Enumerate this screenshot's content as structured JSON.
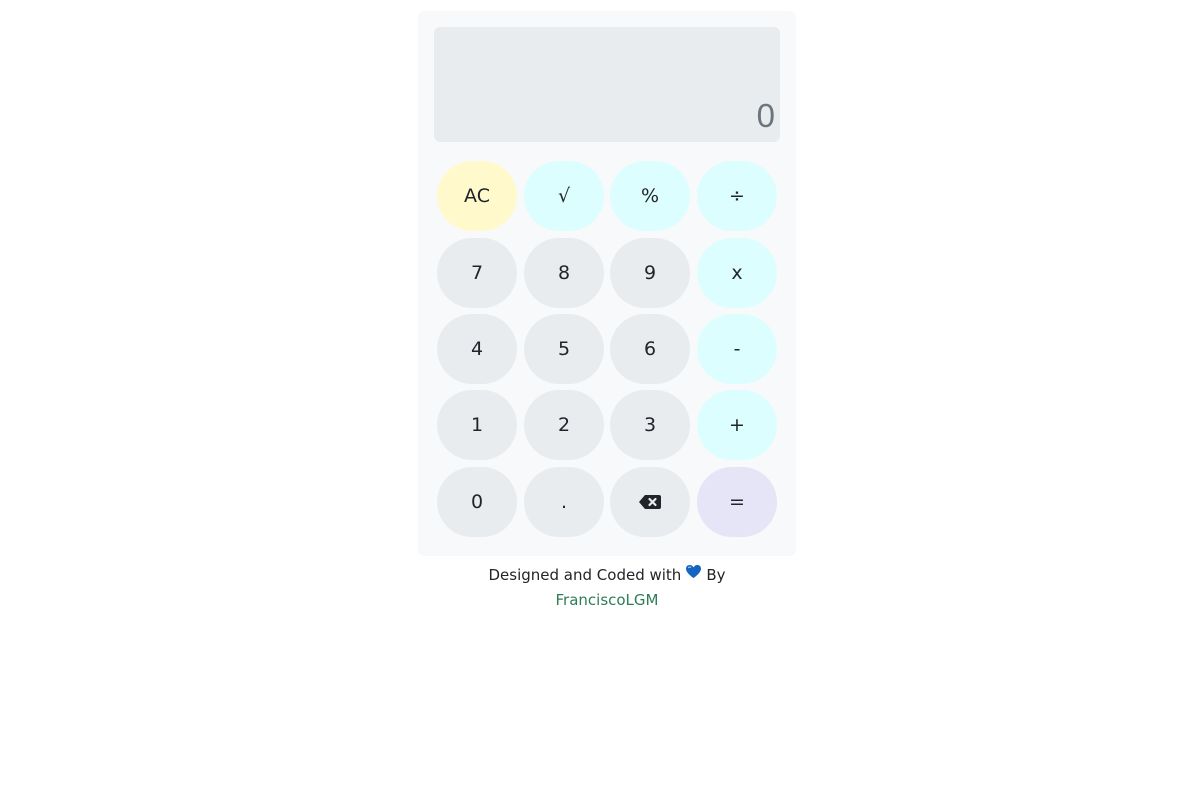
{
  "display": {
    "value": "0"
  },
  "keys": {
    "ac": "AC",
    "sqrt": "√",
    "percent": "%",
    "divide": "÷",
    "seven": "7",
    "eight": "8",
    "nine": "9",
    "multiply": "x",
    "four": "4",
    "five": "5",
    "six": "6",
    "subtract": "-",
    "one": "1",
    "two": "2",
    "three": "3",
    "add": "+",
    "zero": "0",
    "decimal": ".",
    "backspace_icon": "backspace-icon",
    "equals": "="
  },
  "footer": {
    "text_before": "Designed and Coded with",
    "heart_icon": "blue-heart-icon",
    "text_after": "By",
    "author": "FranciscoLGM"
  },
  "colors": {
    "panel": "#f8f9fa",
    "display_bg": "#e9ecef",
    "number_key": "#e9ecef",
    "ac_key": "#fff9cc",
    "operator_key": "#ddfefe",
    "equals_key": "#e5e5f7",
    "link": "#2e7d57",
    "heart": "#1565c0"
  }
}
